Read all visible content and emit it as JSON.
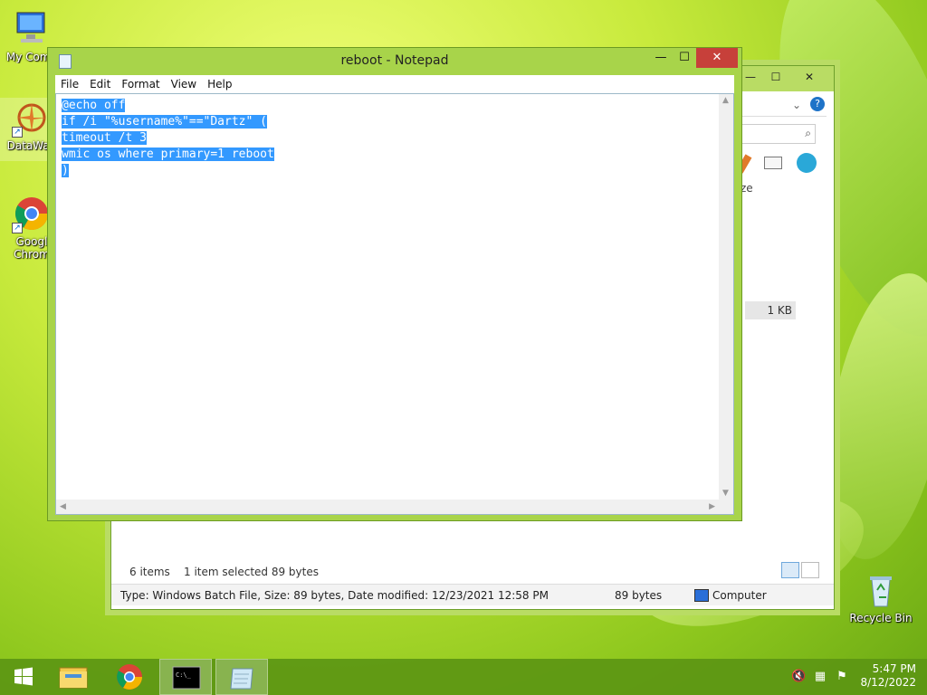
{
  "desktop": {
    "icons": [
      {
        "label": "My Comp"
      },
      {
        "label": "DataWag"
      },
      {
        "label": "Googl\nChrom"
      },
      {
        "label": "Recycle Bin"
      }
    ]
  },
  "explorer": {
    "size_cell": "1 KB",
    "partial_header": "ze",
    "status_items": "6 items",
    "status_selected": "1 item selected  89 bytes",
    "detail_type": "Type: Windows Batch File, Size: 89 bytes, Date modified: 12/23/2021 12:58 PM",
    "detail_size": "89 bytes",
    "detail_location": "Computer"
  },
  "notepad": {
    "title": "reboot - Notepad",
    "menu": [
      "File",
      "Edit",
      "Format",
      "View",
      "Help"
    ],
    "lines": [
      "@echo off",
      "if /i \"%username%\"==\"Dartz\" (",
      "timeout /t 3",
      "wmic os where primary=1 reboot",
      ")"
    ]
  },
  "taskbar": {
    "time": "5:47 PM",
    "date": "8/12/2022"
  },
  "colors": {
    "selection": "#3399ff",
    "close_button": "#c7403a",
    "window_frame": "#a8d44a"
  }
}
